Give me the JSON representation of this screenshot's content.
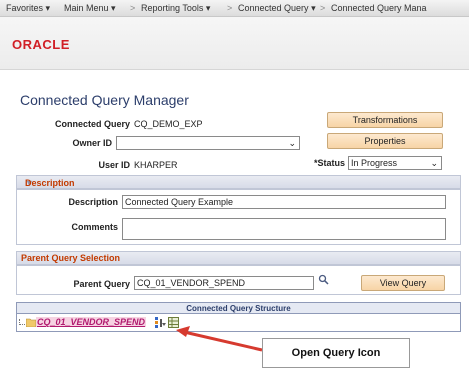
{
  "nav": {
    "favorites": "Favorites",
    "main_menu": "Main Menu",
    "reporting_tools": "Reporting Tools",
    "connected_query": "Connected Query",
    "connected_query_manager_crumb": "Connected Query Mana"
  },
  "brand": {
    "logo_text": "ORACLE"
  },
  "page": {
    "title": "Connected Query Manager"
  },
  "header": {
    "connected_query_label": "Connected Query",
    "connected_query_value": "CQ_DEMO_EXP",
    "owner_id_label": "Owner ID",
    "owner_id_value": "",
    "user_id_label": "User ID",
    "user_id_value": "KHARPER",
    "status_label": "*Status",
    "status_value": "In Progress",
    "transformations_button": "Transformations",
    "properties_button": "Properties"
  },
  "description_section": {
    "title": "Description",
    "description_label": "Description",
    "description_value": "Connected Query Example",
    "comments_label": "Comments",
    "comments_value": ""
  },
  "parent_section": {
    "title": "Parent Query Selection",
    "parent_query_label": "Parent Query",
    "parent_query_value": "CQ_01_VENDOR_SPEND",
    "view_query_button": "View Query"
  },
  "structure": {
    "title": "Connected Query Structure",
    "root_node": "CQ_01_VENDOR_SPEND"
  },
  "annotation": {
    "callout_text": "Open Query Icon"
  },
  "colors": {
    "accent_orange": "#c33a00",
    "oracle_red": "#d11f26",
    "arrow_red": "#d63a2f"
  }
}
